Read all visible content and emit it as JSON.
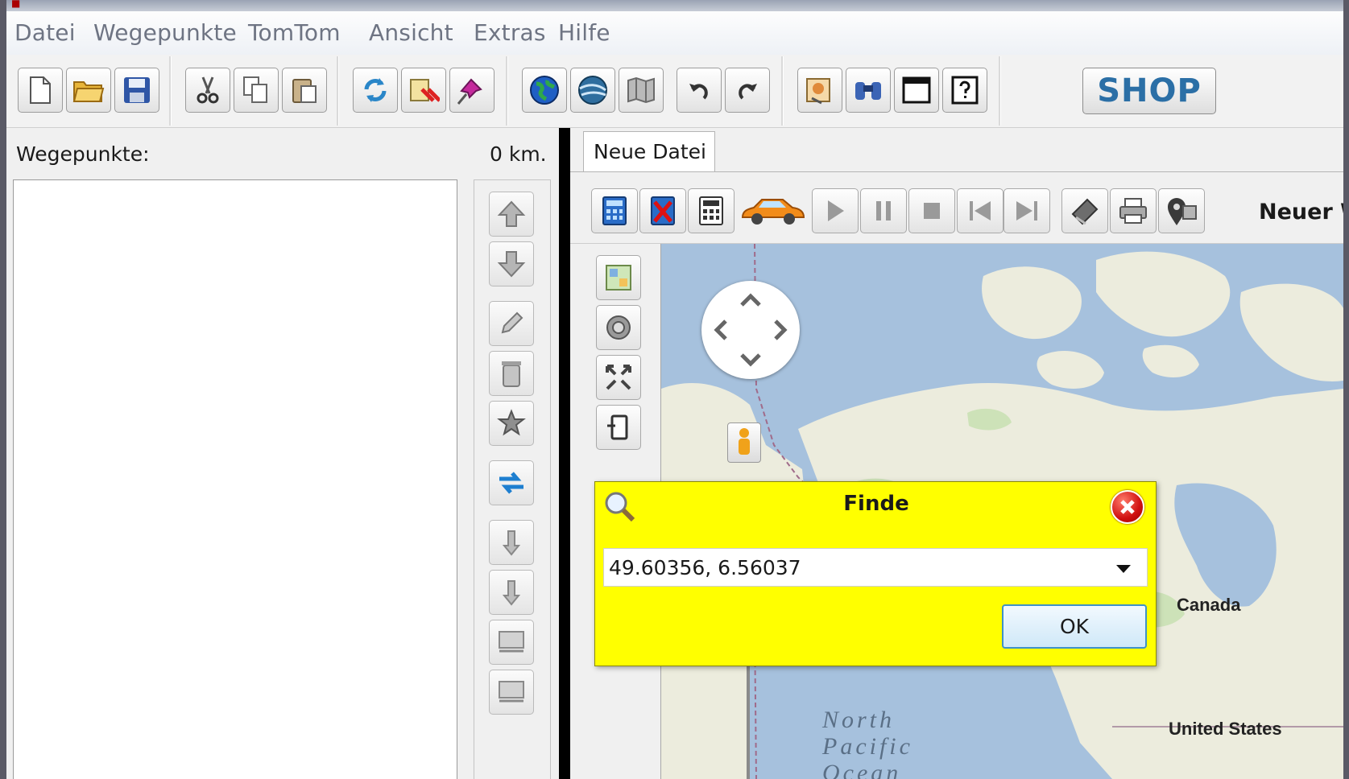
{
  "menubar": {
    "items": [
      "Datei",
      "Wegepunkte",
      "TomTom",
      "Ansicht",
      "Extras",
      "Hilfe"
    ]
  },
  "toolbar": {
    "shop_label": "SHOP"
  },
  "left_panel": {
    "title": "Wegepunkte:",
    "distance": "0 km."
  },
  "tabs": [
    {
      "label": "Neue Datei"
    }
  ],
  "map_toolbar": {
    "route_name": "Neuer W"
  },
  "map": {
    "labels": {
      "canada": "Canada",
      "united_states": "United States",
      "ocean_line1": "North",
      "ocean_line2": "Pacific",
      "ocean_line3": "Ocean"
    }
  },
  "find_dialog": {
    "title": "Finde",
    "value": "49.60356, 6.56037",
    "ok_label": "OK"
  },
  "colors": {
    "dialog_bg": "#ffff00",
    "map_water": "#a6c1dd",
    "map_land": "#ececdd",
    "accent": "#2b6fa6"
  }
}
